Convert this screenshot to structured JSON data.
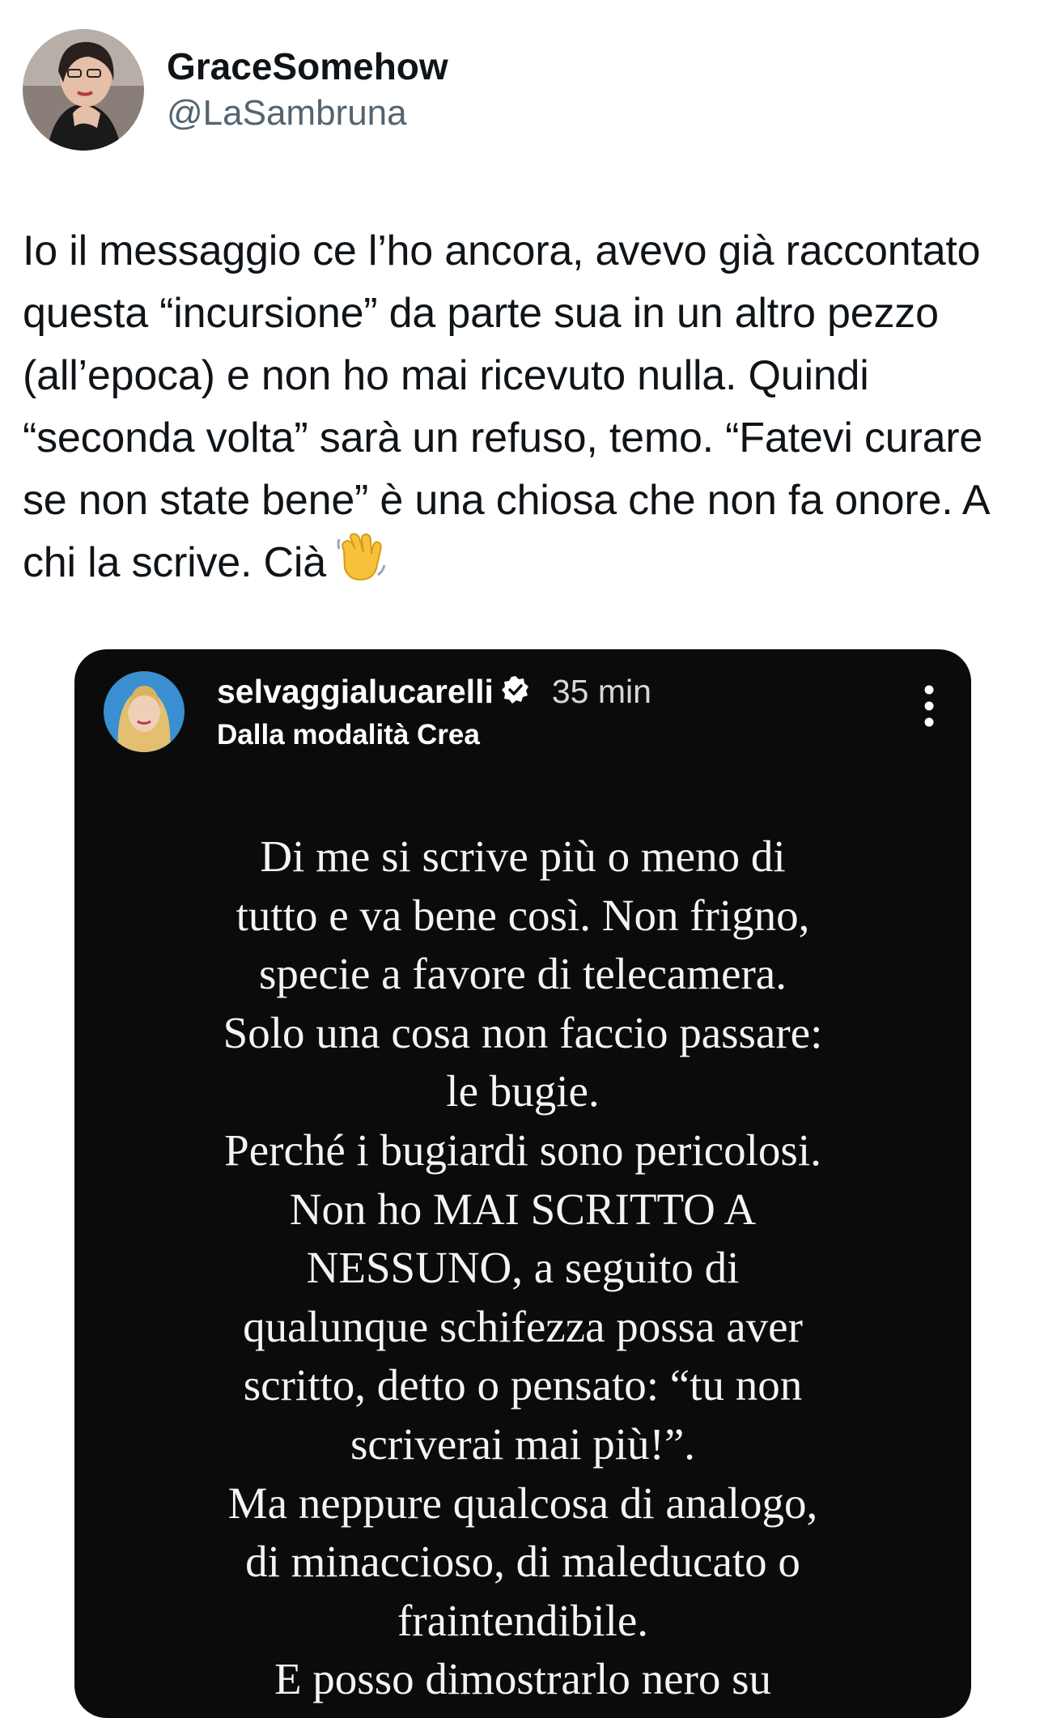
{
  "tweet": {
    "author": {
      "display_name": "GraceSomehow",
      "handle": "@LaSambruna",
      "avatar_icon": "profile-photo"
    },
    "text": "Io il messaggio ce l’ho ancora, avevo già raccontato questa “incursione” da parte sua in un altro pezzo (all’epoca) e non ho mai ricevuto nulla. Quindi “seconda volta” sarà un refuso, temo. “Fatevi curare se non state bene” è una chiosa che non fa onore. A chi la scrive. Cià",
    "emoji_icon": "waving-hand-icon"
  },
  "story": {
    "username": "selvaggialucarelli",
    "verified_icon": "verified-badge-icon",
    "time": "35 min",
    "subtitle": "Dalla modalità Crea",
    "menu_icon": "more-vertical-icon",
    "lines": [
      "Di me si scrive più o meno di",
      "tutto e va bene così. Non frigno,",
      "specie a favore di telecamera.",
      "Solo una cosa non faccio passare:",
      "le bugie.",
      "Perché i bugiardi sono pericolosi.",
      "Non ho MAI SCRITTO A",
      "NESSUNO, a seguito di",
      "qualunque schifezza possa aver",
      "scritto, detto o pensato: “tu non",
      "scriverai mai più!”.",
      "Ma neppure qualcosa di analogo,",
      "di minaccioso, di maleducato o",
      "fraintendibile.",
      "E posso dimostrarlo nero su"
    ]
  },
  "colors": {
    "text_primary": "#0f1419",
    "text_secondary": "#536471",
    "story_background": "#0b0b0b",
    "story_text": "#f4f4f4"
  }
}
